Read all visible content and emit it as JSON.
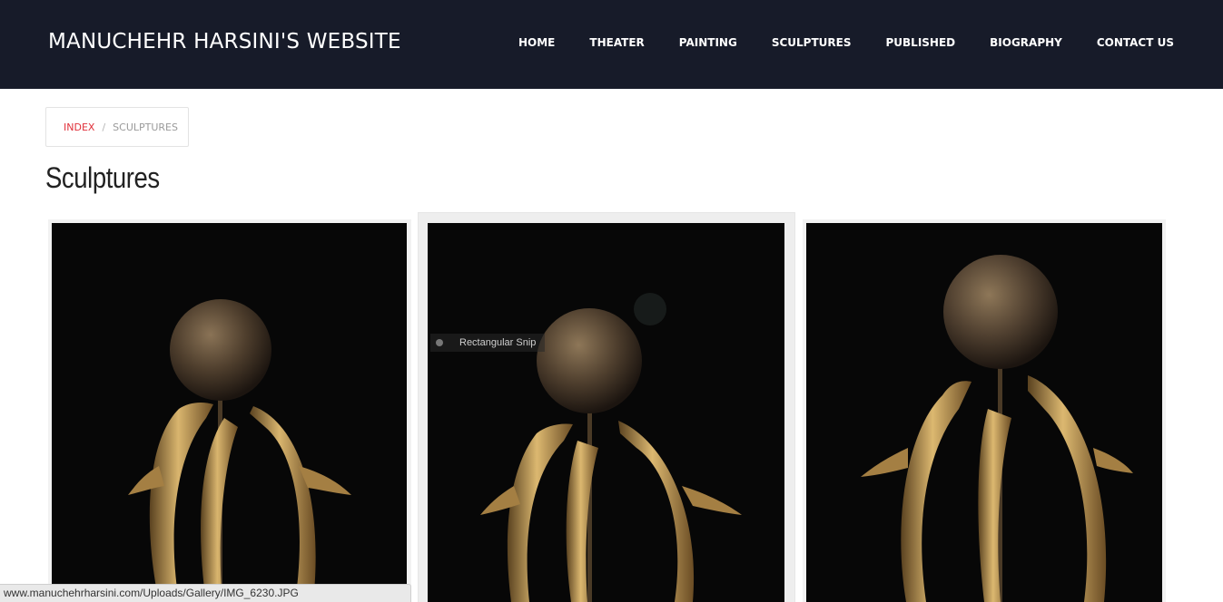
{
  "header": {
    "site_title": "MANUCHEHR HARSINI'S WEBSITE",
    "nav": [
      {
        "label": "HOME"
      },
      {
        "label": "THEATER"
      },
      {
        "label": "PAINTING"
      },
      {
        "label": "SCULPTURES"
      },
      {
        "label": "PUBLISHED"
      },
      {
        "label": "BIOGRAPHY"
      },
      {
        "label": "CONTACT US"
      }
    ]
  },
  "breadcrumb": {
    "index_label": "INDEX",
    "separator": "/",
    "current_label": "SCULPTURES"
  },
  "page": {
    "title": "Sculptures"
  },
  "gallery": {
    "items": [
      {
        "subject": "bronze dolphins with sphere sculpture"
      },
      {
        "subject": "bronze dolphins with sphere sculpture"
      },
      {
        "subject": "bronze dolphins with sphere sculpture"
      }
    ]
  },
  "overlay": {
    "snip_tooltip": "Rectangular Snip"
  },
  "status_bar": {
    "url": "www.manuchehrharsini.com/Uploads/Gallery/IMG_6230.JPG"
  },
  "colors": {
    "header_bg": "#171b29",
    "accent": "#e0303a",
    "bronze": "#b08a4a"
  }
}
